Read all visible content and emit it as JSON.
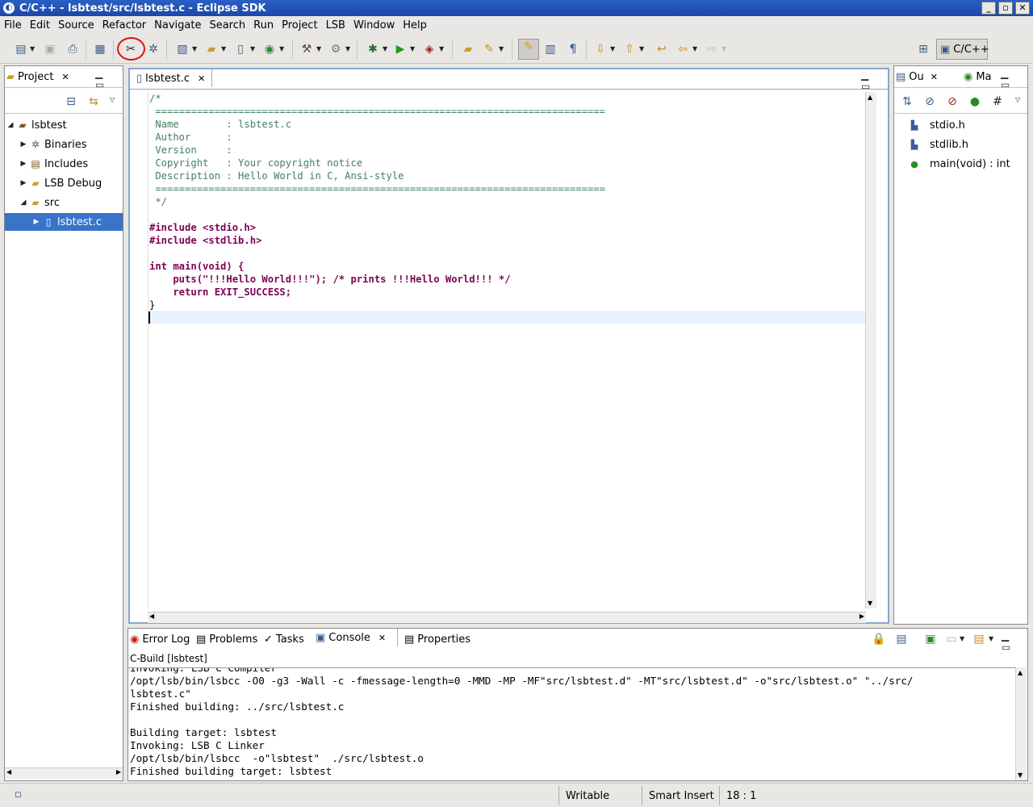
{
  "window": {
    "title": "C/C++ - lsbtest/src/lsbtest.c - Eclipse SDK"
  },
  "menu": [
    "File",
    "Edit",
    "Source",
    "Refactor",
    "Navigate",
    "Search",
    "Run",
    "Project",
    "LSB",
    "Window",
    "Help"
  ],
  "perspective": {
    "label": "C/C++"
  },
  "project_explorer": {
    "tab": "Project",
    "items": [
      {
        "label": "lsbtest",
        "icon": "project-icon"
      },
      {
        "label": "Binaries",
        "icon": "binaries-icon"
      },
      {
        "label": "Includes",
        "icon": "includes-icon"
      },
      {
        "label": "LSB Debug",
        "icon": "folder-icon"
      },
      {
        "label": "src",
        "icon": "folder-icon"
      },
      {
        "label": "lsbtest.c",
        "icon": "c-file-icon"
      }
    ]
  },
  "editor": {
    "tab": "lsbtest.c",
    "lines": [
      "/*",
      " ============================================================================",
      " Name        : lsbtest.c",
      " Author      :",
      " Version     :",
      " Copyright   : Your copyright notice",
      " Description : Hello World in C, Ansi-style",
      " ============================================================================",
      " */",
      "",
      "#include <stdio.h>",
      "#include <stdlib.h>",
      "",
      "int main(void) {",
      "    puts(\"!!!Hello World!!!\"); /* prints !!!Hello World!!! */",
      "    return EXIT_SUCCESS;",
      "}"
    ]
  },
  "outline": {
    "tab1": "Ou",
    "tab2": "Ma",
    "items": [
      "stdio.h",
      "stdlib.h",
      "main(void) : int"
    ]
  },
  "bottom_tabs": [
    "Error Log",
    "Problems",
    "Tasks",
    "Console",
    "Properties"
  ],
  "console": {
    "title": "C-Build [lsbtest]",
    "lines": [
      "Invoking: LSB C Compiler",
      "/opt/lsb/bin/lsbcc -O0 -g3 -Wall -c -fmessage-length=0 -MMD -MP -MF\"src/lsbtest.d\" -MT\"src/lsbtest.d\" -o\"src/lsbtest.o\" \"../src/",
      "lsbtest.c\"",
      "Finished building: ../src/lsbtest.c",
      "",
      "Building target: lsbtest",
      "Invoking: LSB C Linker",
      "/opt/lsb/bin/lsbcc  -o\"lsbtest\"  ./src/lsbtest.o",
      "Finished building target: lsbtest"
    ]
  },
  "status": {
    "writable": "Writable",
    "insert_mode": "Smart Insert",
    "position": "18 : 1"
  }
}
